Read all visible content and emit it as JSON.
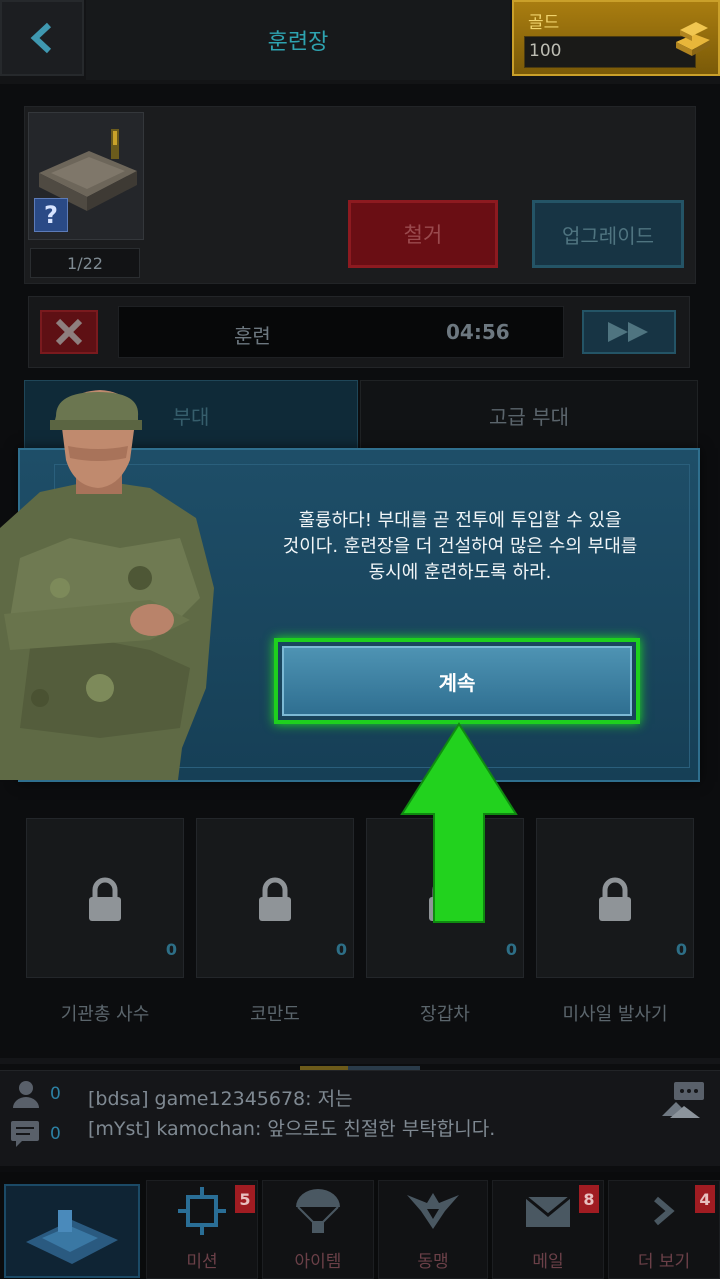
{
  "header": {
    "title": "훈련장",
    "gold_label": "골드",
    "gold_value": "100"
  },
  "building": {
    "help_glyph": "?",
    "count": "1/22",
    "demolish_label": "철거",
    "upgrade_label": "업그레이드"
  },
  "training": {
    "label": "훈련",
    "time": "04:56"
  },
  "tabs": [
    {
      "label": "부대"
    },
    {
      "label": "고급 부대"
    }
  ],
  "modal": {
    "message_lines": [
      "훌륭하다! 부대를 곧 전투에 투입할 수 있을",
      "것이다. 훈련장을 더 건설하여 많은 수의 부대를",
      "동시에 훈련하도록 하라."
    ],
    "continue_label": "계속"
  },
  "units": [
    {
      "name": "기관총 사수",
      "count": "0"
    },
    {
      "name": "코만도",
      "count": "0"
    },
    {
      "name": "장갑차",
      "count": "0"
    },
    {
      "name": "미사일 발사기",
      "count": "0"
    }
  ],
  "chat": {
    "online_count": "0",
    "message_count": "0",
    "lines": [
      "[bdsa] game12345678: 저는",
      "[mYst] kamochan: 앞으로도 친절한 부탁합니다."
    ]
  },
  "nav": {
    "items": [
      {
        "label": "미션",
        "badge": "5",
        "icon": "target-icon"
      },
      {
        "label": "아이템",
        "badge": "",
        "icon": "parachute-icon"
      },
      {
        "label": "동맹",
        "badge": "",
        "icon": "eagle-icon"
      },
      {
        "label": "메일",
        "badge": "8",
        "icon": "mail-icon"
      },
      {
        "label": "더 보기",
        "badge": "4",
        "icon": "chevron-right-icon"
      }
    ]
  },
  "colors": {
    "accent": "#2ea3b0",
    "highlight_green": "#1ed01e",
    "badge_red": "#a01c22"
  }
}
